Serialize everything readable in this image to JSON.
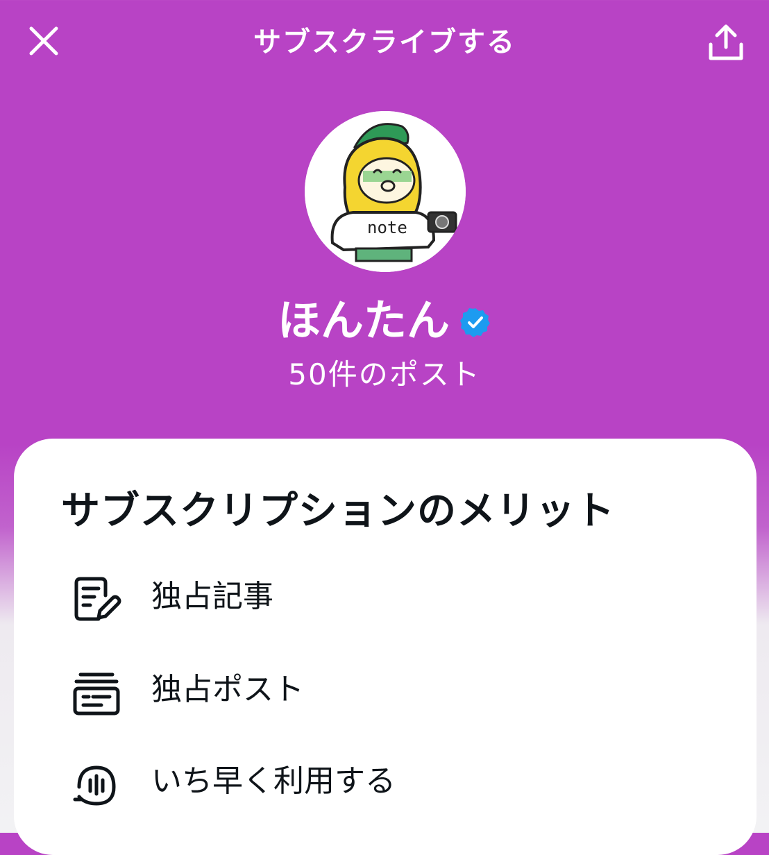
{
  "header": {
    "title": "サブスクライブする",
    "close_icon": "close-icon",
    "share_icon": "share-icon"
  },
  "profile": {
    "name": "ほんたん",
    "post_count": "50件のポスト",
    "verified_icon": "verified-badge-icon",
    "avatar_logo_text": "note"
  },
  "benefits": {
    "title": "サブスクリプションのメリット",
    "items": [
      {
        "label": "独占記事",
        "icon": "article-edit-icon"
      },
      {
        "label": "独占ポスト",
        "icon": "exclusive-post-icon"
      },
      {
        "label": "いち早く利用する",
        "icon": "early-access-icon"
      }
    ]
  },
  "colors": {
    "header_bg": "#b843c5",
    "card_bg": "#ffffff",
    "text_primary": "#0f1419",
    "verified_blue": "#1d9bf0"
  }
}
